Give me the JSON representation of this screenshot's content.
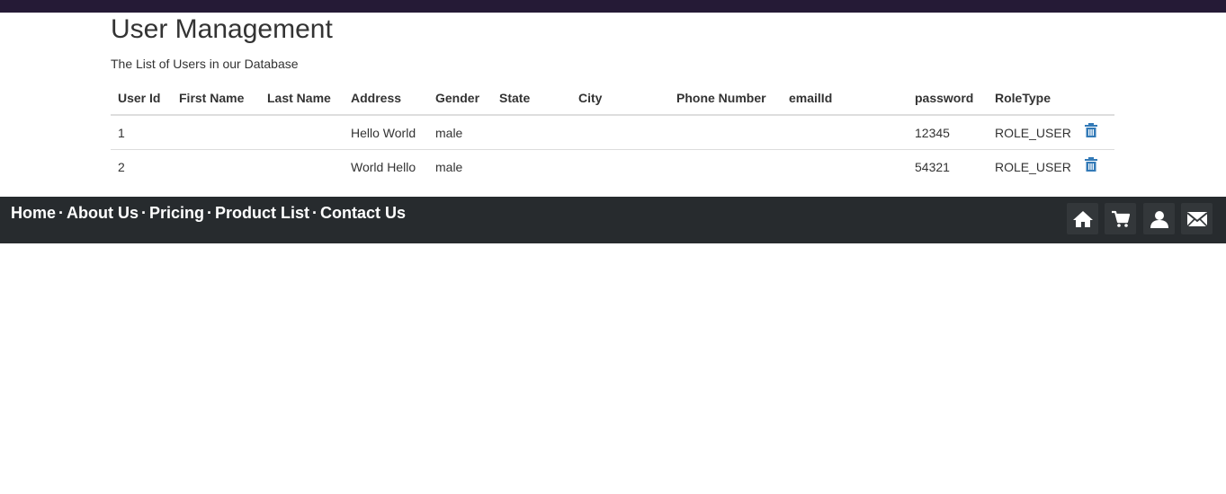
{
  "page": {
    "title": "User Management",
    "subtitle": "The List of Users in our Database"
  },
  "table": {
    "headers": [
      "User Id",
      "First Name",
      "Last Name",
      "Address",
      "Gender",
      "State",
      "City",
      "Phone Number",
      "emailId",
      "password",
      "RoleType"
    ],
    "rows": [
      {
        "user_id": "1",
        "first_name": "",
        "last_name": "",
        "address": "Hello World",
        "gender": "male",
        "state": "",
        "city": "",
        "phone": "",
        "email": "",
        "password": "12345",
        "role": "ROLE_USER"
      },
      {
        "user_id": "2",
        "first_name": "",
        "last_name": "",
        "address": "World Hello",
        "gender": "male",
        "state": "",
        "city": "",
        "phone": "",
        "email": "",
        "password": "54321",
        "role": "ROLE_USER"
      }
    ],
    "row_action_icon": "trash-icon"
  },
  "footer": {
    "links": [
      "Home",
      "About Us",
      "Pricing",
      "Product List",
      "Contact Us"
    ],
    "separator": "·",
    "icons": [
      "home-icon",
      "cart-icon",
      "user-icon",
      "mail-icon"
    ]
  },
  "colors": {
    "topbar": "#251a36",
    "footer": "#272b2e",
    "icon_button": "#33373a",
    "trash_icon": "#337ab7"
  }
}
